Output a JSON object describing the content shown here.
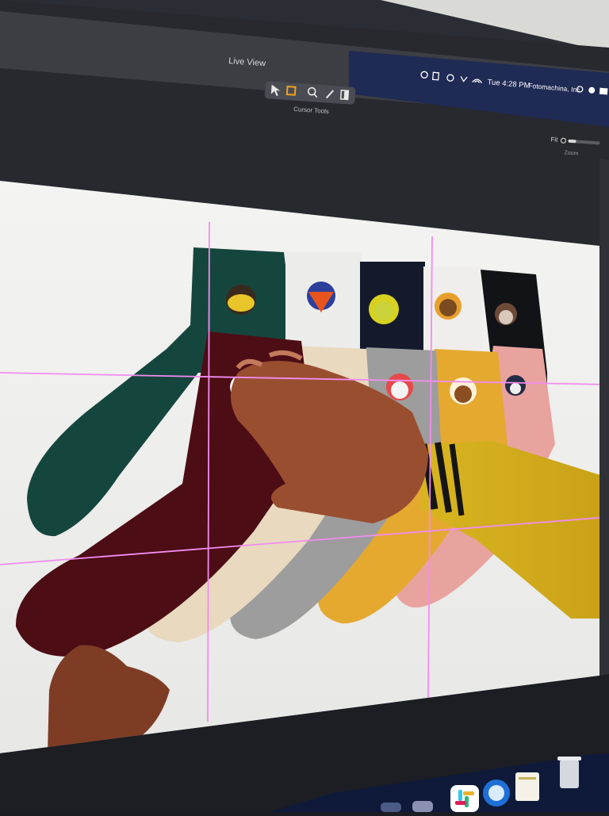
{
  "window": {
    "title": "Live View"
  },
  "toolbar": {
    "tools": [
      "select",
      "crop",
      "zoom",
      "pencil",
      "panel"
    ],
    "group_label": "Cursor Tools"
  },
  "menubar": {
    "time": "Tue 4:28 PM",
    "app": "Fotomachina, Inc"
  },
  "zoom": {
    "fit_label": "Fit",
    "label": "Zoom"
  },
  "photo": {
    "subject": "socks flat-lay",
    "back_row": [
      {
        "color": "#15463d",
        "face": "pikachu"
      },
      {
        "color": "#e9e9e5",
        "face": "fox"
      },
      {
        "color": "#141a2c",
        "face": "chick"
      },
      {
        "color": "#f0eeec",
        "face": "bear"
      },
      {
        "color": "#111316",
        "face": "owl"
      }
    ],
    "front_row": [
      {
        "color": "#4c0d15",
        "face": "panda"
      },
      {
        "color": "#e8d9bf",
        "face": "rabbit"
      },
      {
        "color": "#9d9d9d",
        "face": "penguin-bird"
      },
      {
        "color": "#e5a930",
        "face": "monkey"
      },
      {
        "color": "#e8a39f",
        "face": "penguin"
      }
    ]
  },
  "guides": {
    "color": "#f28cf0"
  },
  "dock": {
    "items": [
      "app",
      "app",
      "slack",
      "browser",
      "notes",
      "trash"
    ]
  }
}
